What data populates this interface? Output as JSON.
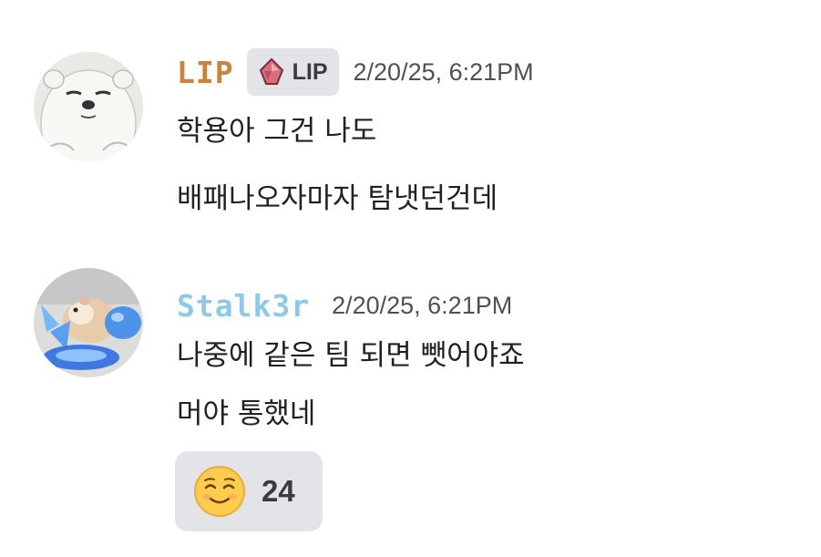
{
  "messages": [
    {
      "username": "LIP",
      "username_color": "#c8833f",
      "tag_label": "LIP",
      "tag_icon": "pink-gem-icon",
      "timestamp": "2/20/25, 6:21PM",
      "avatar": "polar-bear-avatar",
      "lines": [
        "학용아 그건 나도",
        "배패나오자마자 탐냇던건데"
      ]
    },
    {
      "username": "Stalk3r",
      "username_color": "#8fc9e8",
      "timestamp": "2/20/25, 6:21PM",
      "avatar": "hamster-avatar",
      "lines": [
        "나중에 같은 팀 되면 뺏어야죠",
        "머야 통했네"
      ]
    }
  ],
  "reaction": {
    "emoji": "smiling-face-icon",
    "count": "24"
  }
}
